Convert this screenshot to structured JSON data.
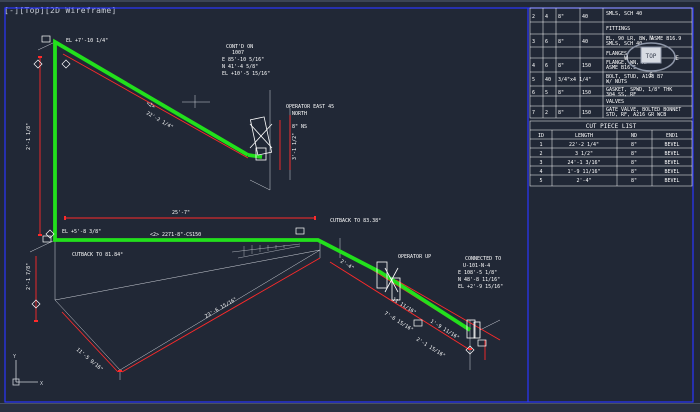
{
  "window": {
    "view_label": "[-][Top][2D Wireframe]"
  },
  "viewcube": {
    "face_label": "TOP",
    "north": "N",
    "east": "E",
    "south": "S",
    "west": "W"
  },
  "bom_rows": [
    {
      "no": "2",
      "qty": "4",
      "size": "8\"",
      "item": "40",
      "desc": "SMLS, SCH 40"
    },
    {
      "section": "FITTINGS"
    },
    {
      "no": "3",
      "qty": "6",
      "size": "8\"",
      "item": "40",
      "desc": "EL, 90 LR, BW, ASME B16.9\nSMLS, SCH 40"
    },
    {
      "section": "FLANGES"
    },
    {
      "no": "4",
      "qty": "6",
      "size": "8\"",
      "item": "150",
      "desc": "FLANGE, WN, RF\nASME B16.5"
    },
    {
      "no": "5",
      "qty": "40",
      "size": "3/4\"x4 1/4\"",
      "item": "",
      "desc": "BOLT, STUD, A193 B7\nW/ NUTS"
    },
    {
      "no": "6",
      "qty": "5",
      "size": "8\"",
      "item": "150",
      "desc": "GASKET, SPWD, 1/8\" THK\n304 SS, RF"
    },
    {
      "section": "VALVES"
    },
    {
      "no": "7",
      "qty": "2",
      "size": "8\"",
      "item": "150",
      "desc": "GATE VALVE, BOLTED BONNET\nSTD, RF, A216 GR WCB"
    }
  ],
  "cut_list": {
    "title": "CUT PIECE LIST",
    "headers": [
      "ID",
      "LENGTH",
      "ND",
      "END1"
    ],
    "rows": [
      [
        "1",
        "22'-2 1/4\"",
        "8\"",
        "BEVEL"
      ],
      [
        "2",
        "3 1/2\"",
        "8\"",
        "BEVEL"
      ],
      [
        "3",
        "24'-1 3/16\"",
        "8\"",
        "BEVEL"
      ],
      [
        "4",
        "1'-9 11/16\"",
        "8\"",
        "BEVEL"
      ],
      [
        "5",
        "2'-4\"",
        "8\"",
        "BEVEL"
      ]
    ]
  },
  "labels": {
    "contd": "CONT'D ON",
    "contd_ref": "1007",
    "coord_e1": "E 85'-10 5/16\"",
    "coord_n1": "N 41'-4 5/8\"",
    "coord_el1": "EL +10'-5 15/16\"",
    "operator_east": "OPERATOR EAST 45",
    "north": "NORTH",
    "gate_1": "8\" NS",
    "el_top": "EL +7'-10 1/4\"",
    "el_mid": "EL +5'-8 3/8\"",
    "cutback_1": "CUTBACK TO 81.84°",
    "cutback_2": "CUTBACK TO 83.38°",
    "dim_top_diag": "22'-2 1/4\"",
    "dim_top_tag": "<2>",
    "dim_vert": "2'-1 1/8\"",
    "dim_horiz": "25'-7\"",
    "pipe_tag": "<2>  2271-8\"-CS150",
    "dim_lower_diag": "23'-6 15/16\"",
    "dim_lower_left": "11'-5 9/16\"",
    "connected": "CONNECTED TO",
    "conn_ref": "U-101-N-4",
    "coord_e2": "E 108'-5 1/8\"",
    "coord_n2": "N 48'-8 11/16\"",
    "coord_el2": "EL +2'-9 15/16\"",
    "operator_up": "OPERATOR UP",
    "dim_r1": "2'-4\"",
    "dim_r2": "1'-9 11/16\"",
    "dim_r3": "2'-1 15/16\"",
    "dim_r4": "11 11/16\"",
    "dim_r5": "7'-6 15/16\"",
    "dim_v2": "3'-1 1/2\"",
    "dim_left_vert": "2'-1 7/8\""
  },
  "colors": {
    "pipe": "#22e01c",
    "dim": "#ff2a2a",
    "annot": "#ffffff",
    "bg": "#212836",
    "border": "#2a36ff"
  }
}
